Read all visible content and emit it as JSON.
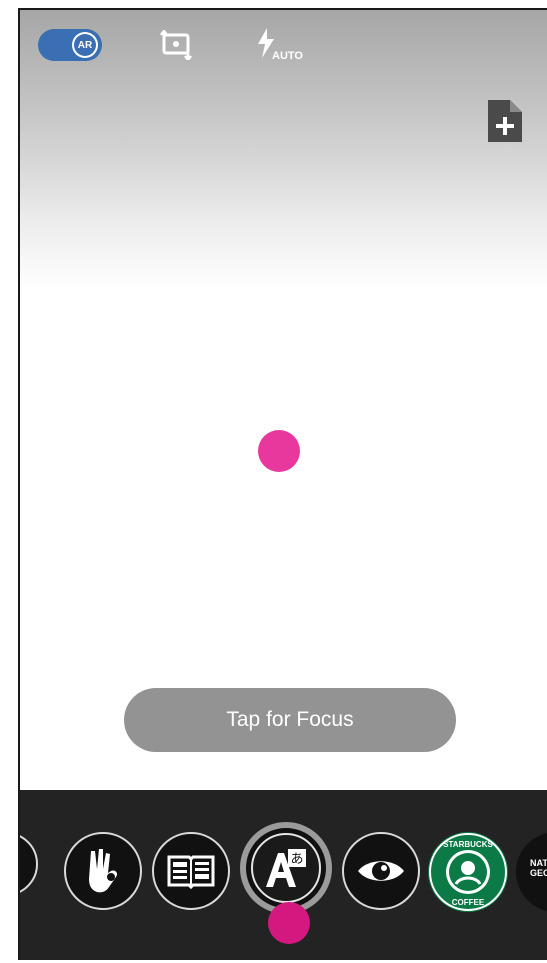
{
  "top_bar": {
    "ar_toggle_label": "AR",
    "flash_mode_label": "AUTO"
  },
  "camera": {
    "focus_button_label": "Tap for Focus"
  },
  "lenses": {
    "items": [
      {
        "name": "partial-lens"
      },
      {
        "name": "ok-hand"
      },
      {
        "name": "book"
      },
      {
        "name": "translate",
        "selected": true
      },
      {
        "name": "eye"
      },
      {
        "name": "starbucks"
      },
      {
        "name": "national-geographic",
        "text": "NAT GEO"
      }
    ],
    "starbucks_text_top": "STARBUCKS",
    "starbucks_text_bottom": "COFFEE"
  },
  "colors": {
    "accent_pink": "#e8389e",
    "toggle_blue": "#3a6fb3",
    "lens_bar_bg": "#232323",
    "focus_pill_bg": "#939393"
  }
}
